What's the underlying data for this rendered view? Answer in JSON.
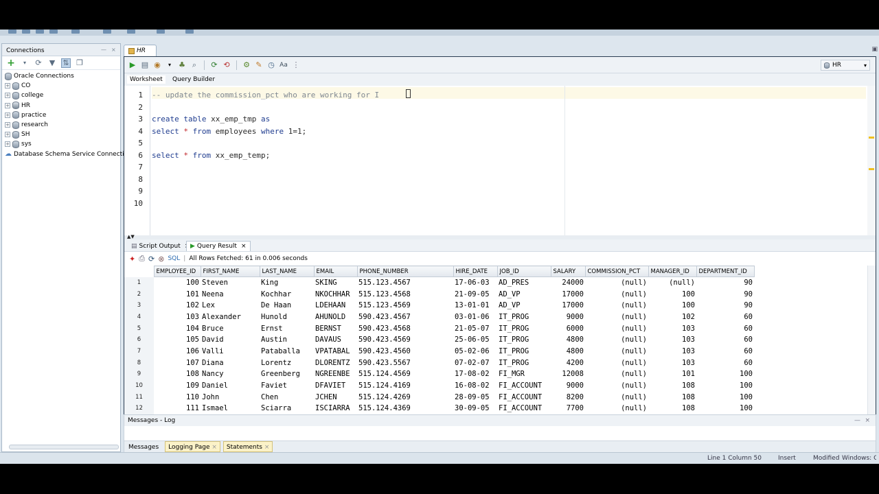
{
  "connections_panel": {
    "title": "Connections",
    "tree": [
      {
        "label": "Oracle Connections",
        "type": "root"
      },
      {
        "label": "CO",
        "type": "conn"
      },
      {
        "label": "college",
        "type": "conn"
      },
      {
        "label": "HR",
        "type": "conn"
      },
      {
        "label": "practice",
        "type": "conn"
      },
      {
        "label": "research",
        "type": "conn"
      },
      {
        "label": "SH",
        "type": "conn"
      },
      {
        "label": "sys",
        "type": "conn"
      },
      {
        "label": "Database Schema Service Connections",
        "type": "cloud"
      }
    ]
  },
  "editor": {
    "tab_label": "HR",
    "connection_select": "HR",
    "subtabs": [
      "Worksheet",
      "Query Builder"
    ],
    "line_numbers": [
      "1",
      "2",
      "3",
      "4",
      "5",
      "6",
      "7",
      "8",
      "9",
      "10"
    ]
  },
  "results": {
    "tabs": [
      "Script Output",
      "Query Result"
    ],
    "sql_label": "SQL",
    "fetch_status": "All Rows Fetched: 61 in 0.006 seconds",
    "columns": [
      "EMPLOYEE_ID",
      "FIRST_NAME",
      "LAST_NAME",
      "EMAIL",
      "PHONE_NUMBER",
      "HIRE_DATE",
      "JOB_ID",
      "SALARY",
      "COMMISSION_PCT",
      "MANAGER_ID",
      "DEPARTMENT_ID"
    ],
    "rows": [
      [
        "1",
        "100",
        "Steven",
        "King",
        "SKING",
        "515.123.4567",
        "17-06-03",
        "AD_PRES",
        "24000",
        "(null)",
        "(null)",
        "90"
      ],
      [
        "2",
        "101",
        "Neena",
        "Kochhar",
        "NKOCHHAR",
        "515.123.4568",
        "21-09-05",
        "AD_VP",
        "17000",
        "(null)",
        "100",
        "90"
      ],
      [
        "3",
        "102",
        "Lex",
        "De Haan",
        "LDEHAAN",
        "515.123.4569",
        "13-01-01",
        "AD_VP",
        "17000",
        "(null)",
        "100",
        "90"
      ],
      [
        "4",
        "103",
        "Alexander",
        "Hunold",
        "AHUNOLD",
        "590.423.4567",
        "03-01-06",
        "IT_PROG",
        "9000",
        "(null)",
        "102",
        "60"
      ],
      [
        "5",
        "104",
        "Bruce",
        "Ernst",
        "BERNST",
        "590.423.4568",
        "21-05-07",
        "IT_PROG",
        "6000",
        "(null)",
        "103",
        "60"
      ],
      [
        "6",
        "105",
        "David",
        "Austin",
        "DAVAUS",
        "590.423.4569",
        "25-06-05",
        "IT_PROG",
        "4800",
        "(null)",
        "103",
        "60"
      ],
      [
        "7",
        "106",
        "Valli",
        "Pataballa",
        "VPATABAL",
        "590.423.4560",
        "05-02-06",
        "IT_PROG",
        "4800",
        "(null)",
        "103",
        "60"
      ],
      [
        "8",
        "107",
        "Diana",
        "Lorentz",
        "DLORENTZ",
        "590.423.5567",
        "07-02-07",
        "IT_PROG",
        "4200",
        "(null)",
        "103",
        "60"
      ],
      [
        "9",
        "108",
        "Nancy",
        "Greenberg",
        "NGREENBE",
        "515.124.4569",
        "17-08-02",
        "FI_MGR",
        "12008",
        "(null)",
        "101",
        "100"
      ],
      [
        "10",
        "109",
        "Daniel",
        "Faviet",
        "DFAVIET",
        "515.124.4169",
        "16-08-02",
        "FI_ACCOUNT",
        "9000",
        "(null)",
        "108",
        "100"
      ],
      [
        "11",
        "110",
        "John",
        "Chen",
        "JCHEN",
        "515.124.4269",
        "28-09-05",
        "FI_ACCOUNT",
        "8200",
        "(null)",
        "108",
        "100"
      ],
      [
        "12",
        "111",
        "Ismael",
        "Sciarra",
        "ISCIARRA",
        "515.124.4369",
        "30-09-05",
        "FI_ACCOUNT",
        "7700",
        "(null)",
        "108",
        "100"
      ]
    ]
  },
  "log": {
    "title": "Messages - Log",
    "tabs": [
      "Messages",
      "Logging Page",
      "Statements"
    ]
  },
  "status_bar": {
    "position": "Line 1 Column 50",
    "mode": "Insert",
    "modified": "Modified",
    "eol": "Windows: CR"
  },
  "colors": {
    "keyword": "#1f3c8f",
    "comment": "#7e8791",
    "highlight_line": "#fdf9e6"
  }
}
